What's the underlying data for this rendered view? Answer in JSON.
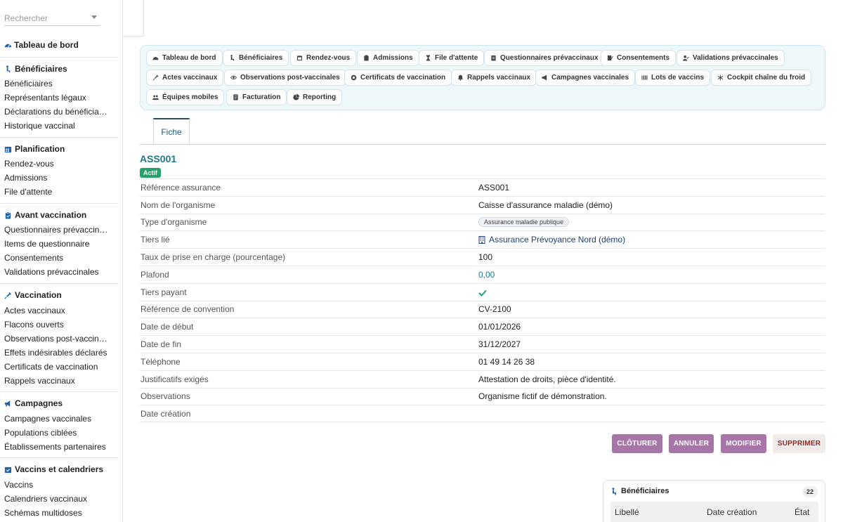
{
  "search": {
    "placeholder": "Rechercher"
  },
  "sidebar": {
    "dashboard": "Tableau de bord",
    "sections": [
      {
        "title": "Bénéficiaires",
        "icon": "person-sitting-icon",
        "items": [
          "Bénéficiaires",
          "Représentants légaux",
          "Déclarations du bénéficia…",
          "Historique vaccinal"
        ]
      },
      {
        "title": "Planification",
        "icon": "calendar-icon",
        "items": [
          "Rendez-vous",
          "Admissions",
          "File d'attente"
        ]
      },
      {
        "title": "Avant vaccination",
        "icon": "clipboard-icon",
        "items": [
          "Questionnaires prévaccin…",
          "Items de questionnaire",
          "Consentements",
          "Validations prévaccinales"
        ]
      },
      {
        "title": "Vaccination",
        "icon": "syringe-icon",
        "items": [
          "Actes vaccinaux",
          "Flacons ouverts",
          "Observations post-vaccin…",
          "Effets indésirables déclarés",
          "Certificats de vaccination",
          "Rappels vaccinaux"
        ]
      },
      {
        "title": "Campagnes",
        "icon": "megaphone-icon",
        "items": [
          "Campagnes vaccinales",
          "Populations ciblées",
          "Établissements partenaires"
        ]
      },
      {
        "title": "Vaccins et calendriers",
        "icon": "calendar-check-icon",
        "items": [
          "Vaccins",
          "Calendriers vaccinaux",
          "Schémas multidoses"
        ]
      }
    ]
  },
  "topnav": {
    "rows": [
      [
        "Tableau de bord",
        "Bénéficiaires",
        "Rendez-vous",
        "Admissions",
        "File d'attente",
        "Questionnaires prévaccinaux",
        "Consentements",
        "Validations prévaccinales"
      ],
      [
        "Actes vaccinaux",
        "Observations post-vaccinales",
        "Certificats de vaccination",
        "Rappels vaccinaux",
        "Campagnes vaccinales",
        "Lots de vaccins",
        "Cockpit chaîne du froid"
      ],
      [
        "Équipes mobiles",
        "Facturation",
        "Reporting"
      ]
    ]
  },
  "tabs": {
    "fiche": "Fiche"
  },
  "record": {
    "title": "ASS001",
    "status": "Actif",
    "fields": [
      {
        "label": "Référence assurance",
        "value": "ASS001"
      },
      {
        "label": "Nom de l'organisme",
        "value": "Caisse d'assurance maladie (démo)"
      },
      {
        "label": "Type d'organisme",
        "value": "Assurance maladie publique"
      },
      {
        "label": "Tiers lié",
        "value": "Assurance Prévoyance Nord (démo)"
      },
      {
        "label": "Taux de prise en charge (pourcentage)",
        "value": "100"
      },
      {
        "label": "Plafond",
        "value": "0,00"
      },
      {
        "label": "Tiers payant",
        "value": ""
      },
      {
        "label": "Référence de convention",
        "value": "CV-2100"
      },
      {
        "label": "Date de début",
        "value": "01/01/2026"
      },
      {
        "label": "Date de fin",
        "value": "31/12/2027"
      },
      {
        "label": "Téléphone",
        "value": "01 49 14 26 38"
      },
      {
        "label": "Justificatifs exigés",
        "value": "Attestation de droits, pièce d'identité."
      },
      {
        "label": "Observations",
        "value": "Organisme fictif de démonstration."
      },
      {
        "label": "Date création",
        "value": ""
      }
    ]
  },
  "actions": {
    "cloturer": "CLÔTURER",
    "annuler": "ANNULER",
    "modifier": "MODIFIER",
    "supprimer": "SUPPRIMER"
  },
  "card": {
    "title": "Bénéficiaires",
    "count": "22",
    "columns": [
      "Libellé",
      "Date création",
      "État"
    ]
  },
  "colors": {
    "accent": "#1b7a8a",
    "purple": "#a576a6",
    "success": "#28a06b",
    "navy": "#1e3f78"
  }
}
